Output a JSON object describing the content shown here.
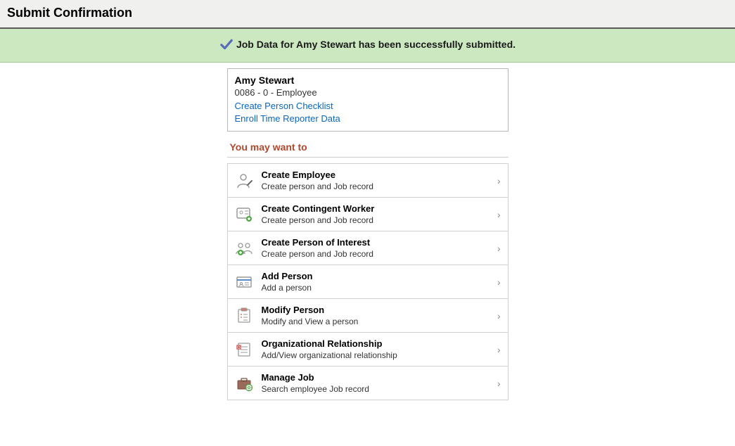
{
  "header": {
    "title": "Submit Confirmation"
  },
  "banner": {
    "message": "Job Data for Amy Stewart has been successfully submitted."
  },
  "person": {
    "name": "Amy Stewart",
    "subline": "0086 - 0 - Employee",
    "links": [
      {
        "label": "Create Person Checklist"
      },
      {
        "label": "Enroll Time Reporter Data"
      }
    ]
  },
  "section": {
    "title": "You may want to"
  },
  "actions": [
    {
      "icon": "person-add-icon",
      "title": "Create Employee",
      "desc": "Create person and Job record"
    },
    {
      "icon": "contingent-worker-icon",
      "title": "Create Contingent Worker",
      "desc": "Create person and Job record"
    },
    {
      "icon": "people-interest-icon",
      "title": "Create Person of Interest",
      "desc": "Create person and Job record"
    },
    {
      "icon": "add-person-card-icon",
      "title": "Add Person",
      "desc": "Add a person"
    },
    {
      "icon": "modify-person-icon",
      "title": "Modify Person",
      "desc": "Modify and View a person"
    },
    {
      "icon": "org-relationship-icon",
      "title": "Organizational Relationship",
      "desc": "Add/View organizational relationship"
    },
    {
      "icon": "manage-job-icon",
      "title": "Manage Job",
      "desc": "Search employee Job record"
    }
  ]
}
